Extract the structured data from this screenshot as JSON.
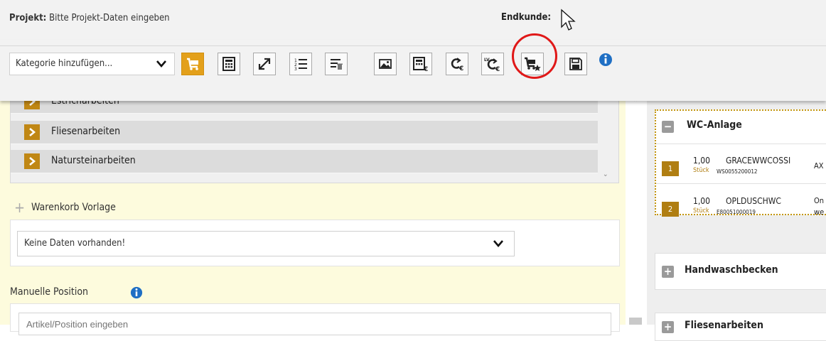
{
  "header": {
    "project_label": "Projekt:",
    "project_value": "Bitte Projekt-Daten eingeben",
    "customer_label": "Endkunde:"
  },
  "toolbar": {
    "category_select": "Kategorie hinzufügen...",
    "buttons": [
      {
        "name": "warenkorb-vorlage-button",
        "icon": "cart-icon",
        "active": true
      },
      {
        "name": "calculator-button",
        "icon": "calculator-icon"
      },
      {
        "name": "expand-button",
        "icon": "expand-arrows-icon"
      },
      {
        "name": "numbered-list-button",
        "icon": "numbered-list-icon"
      },
      {
        "name": "delete-list-button",
        "icon": "list-delete-icon"
      },
      {
        "name": "image-button",
        "icon": "image-icon"
      },
      {
        "name": "calculate-euro-button",
        "icon": "calculator-euro-icon"
      },
      {
        "name": "refresh-prices-button",
        "icon": "refresh-euro-icon"
      },
      {
        "name": "lv-refresh-button",
        "icon": "lv-refresh-euro-icon"
      },
      {
        "name": "cart-favorite-button",
        "icon": "cart-star-icon",
        "highlighted": true
      },
      {
        "name": "save-button",
        "icon": "save-icon"
      }
    ],
    "info_icon": "info-icon",
    "accent_color": "#e3a01b",
    "highlight_color": "#e01818"
  },
  "categories": {
    "items": [
      "Estricharbeiten",
      "Fliesenarbeiten",
      "Natursteinarbeiten"
    ]
  },
  "warenkorb": {
    "title": "Warenkorb Vorlage",
    "select_value": "Keine Daten vorhanden!"
  },
  "manual": {
    "title": "Manuelle Position",
    "placeholder": "Artikel/Position eingeben"
  },
  "groups": {
    "wc": {
      "title": "WC-Anlage",
      "positions": [
        {
          "num": "1",
          "qty": "1,00",
          "unit": "Stück",
          "code": "GRACEWWCOSSI",
          "article": "WS0055200012",
          "desc": "AX"
        },
        {
          "num": "2",
          "qty": "1,00",
          "unit": "Stück",
          "code": "OPLDUSCHWC",
          "article": "E80051000019",
          "desc": "On",
          "desc2": "we"
        }
      ]
    },
    "handwaschbecken": {
      "title": "Handwaschbecken"
    },
    "fliesenarbeiten": {
      "title": "Fliesenarbeiten"
    }
  }
}
